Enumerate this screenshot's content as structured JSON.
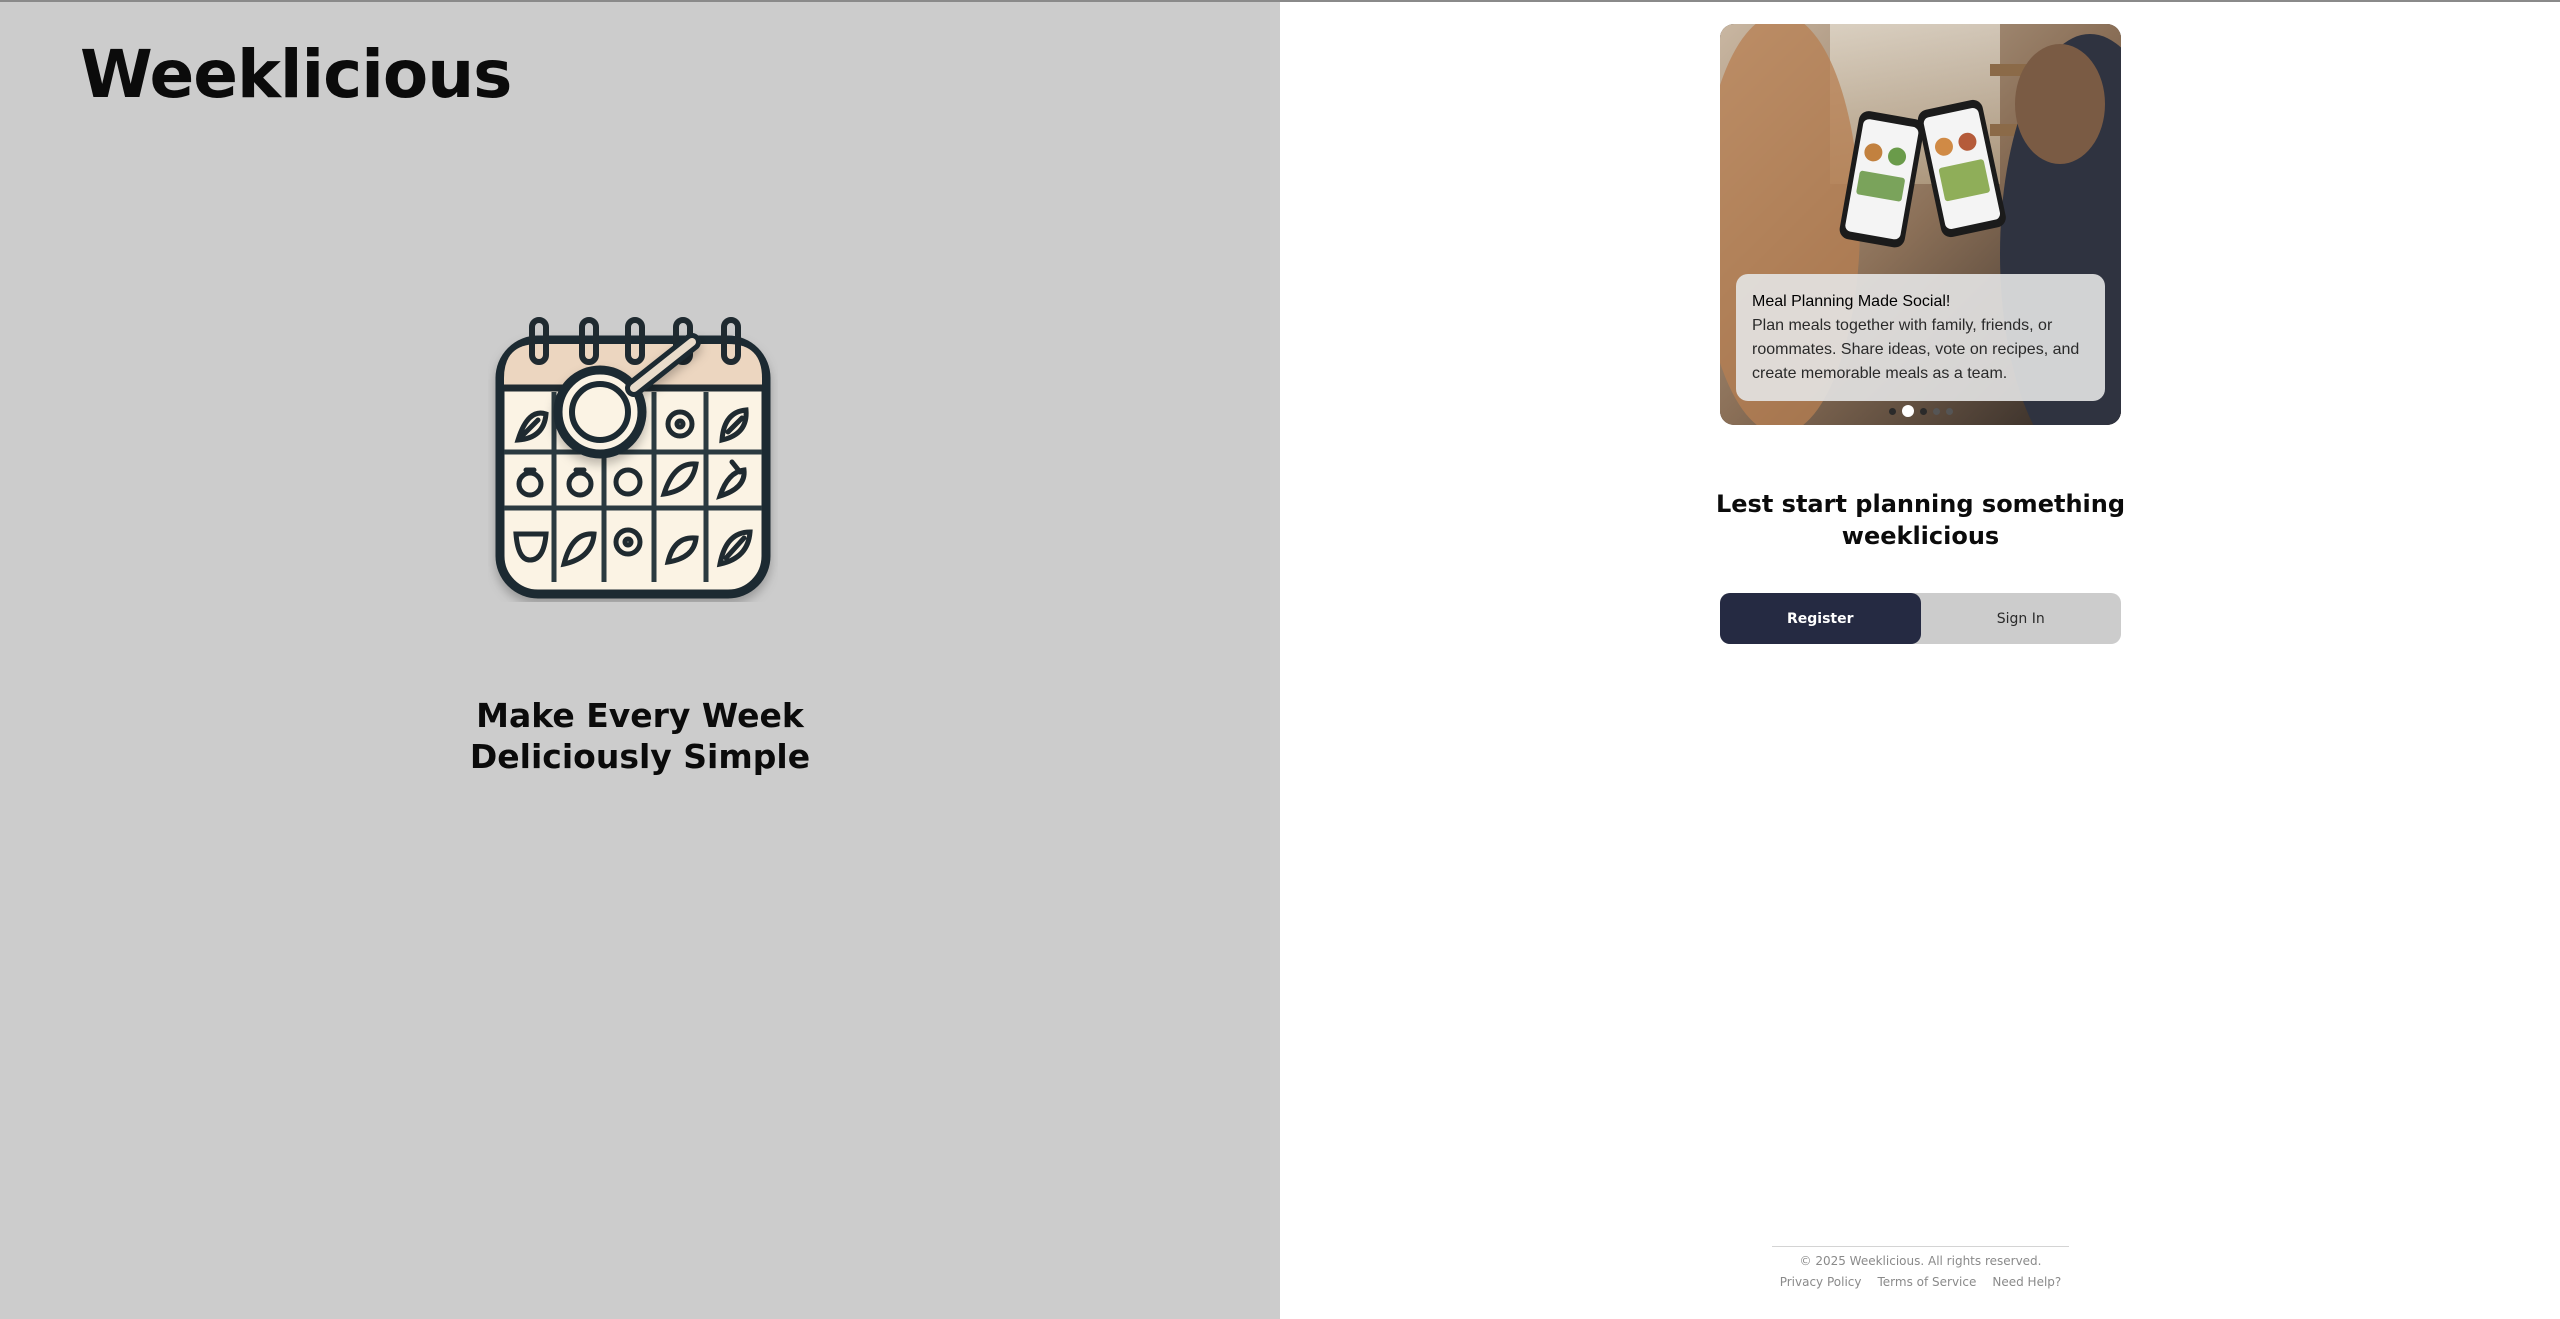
{
  "brand": {
    "name": "Weeklicious"
  },
  "hero": {
    "tagline_line1": "Make Every Week",
    "tagline_line2": "Deliciously Simple"
  },
  "carousel": {
    "slides_count": 5,
    "active_index": 1,
    "title": "Meal Planning Made Social!",
    "text": "Plan meals together with family, friends, or roommates. Share ideas, vote on recipes, and create memorable meals as a team."
  },
  "main": {
    "heading_line1": "Lest start planning something",
    "heading_line2": "weeklicious"
  },
  "auth": {
    "register_label": "Register",
    "signin_label": "Sign In"
  },
  "footer": {
    "copyright": "© 2025 Weeklicious. All rights reserved.",
    "links": [
      "Privacy Policy",
      "Terms of Service",
      "Need Help?"
    ]
  },
  "colors": {
    "left_bg": "#cccccc",
    "primary": "#252a42",
    "toggle_bg": "#cccccc"
  },
  "icons": {
    "hero": "calendar-pan-icon"
  }
}
